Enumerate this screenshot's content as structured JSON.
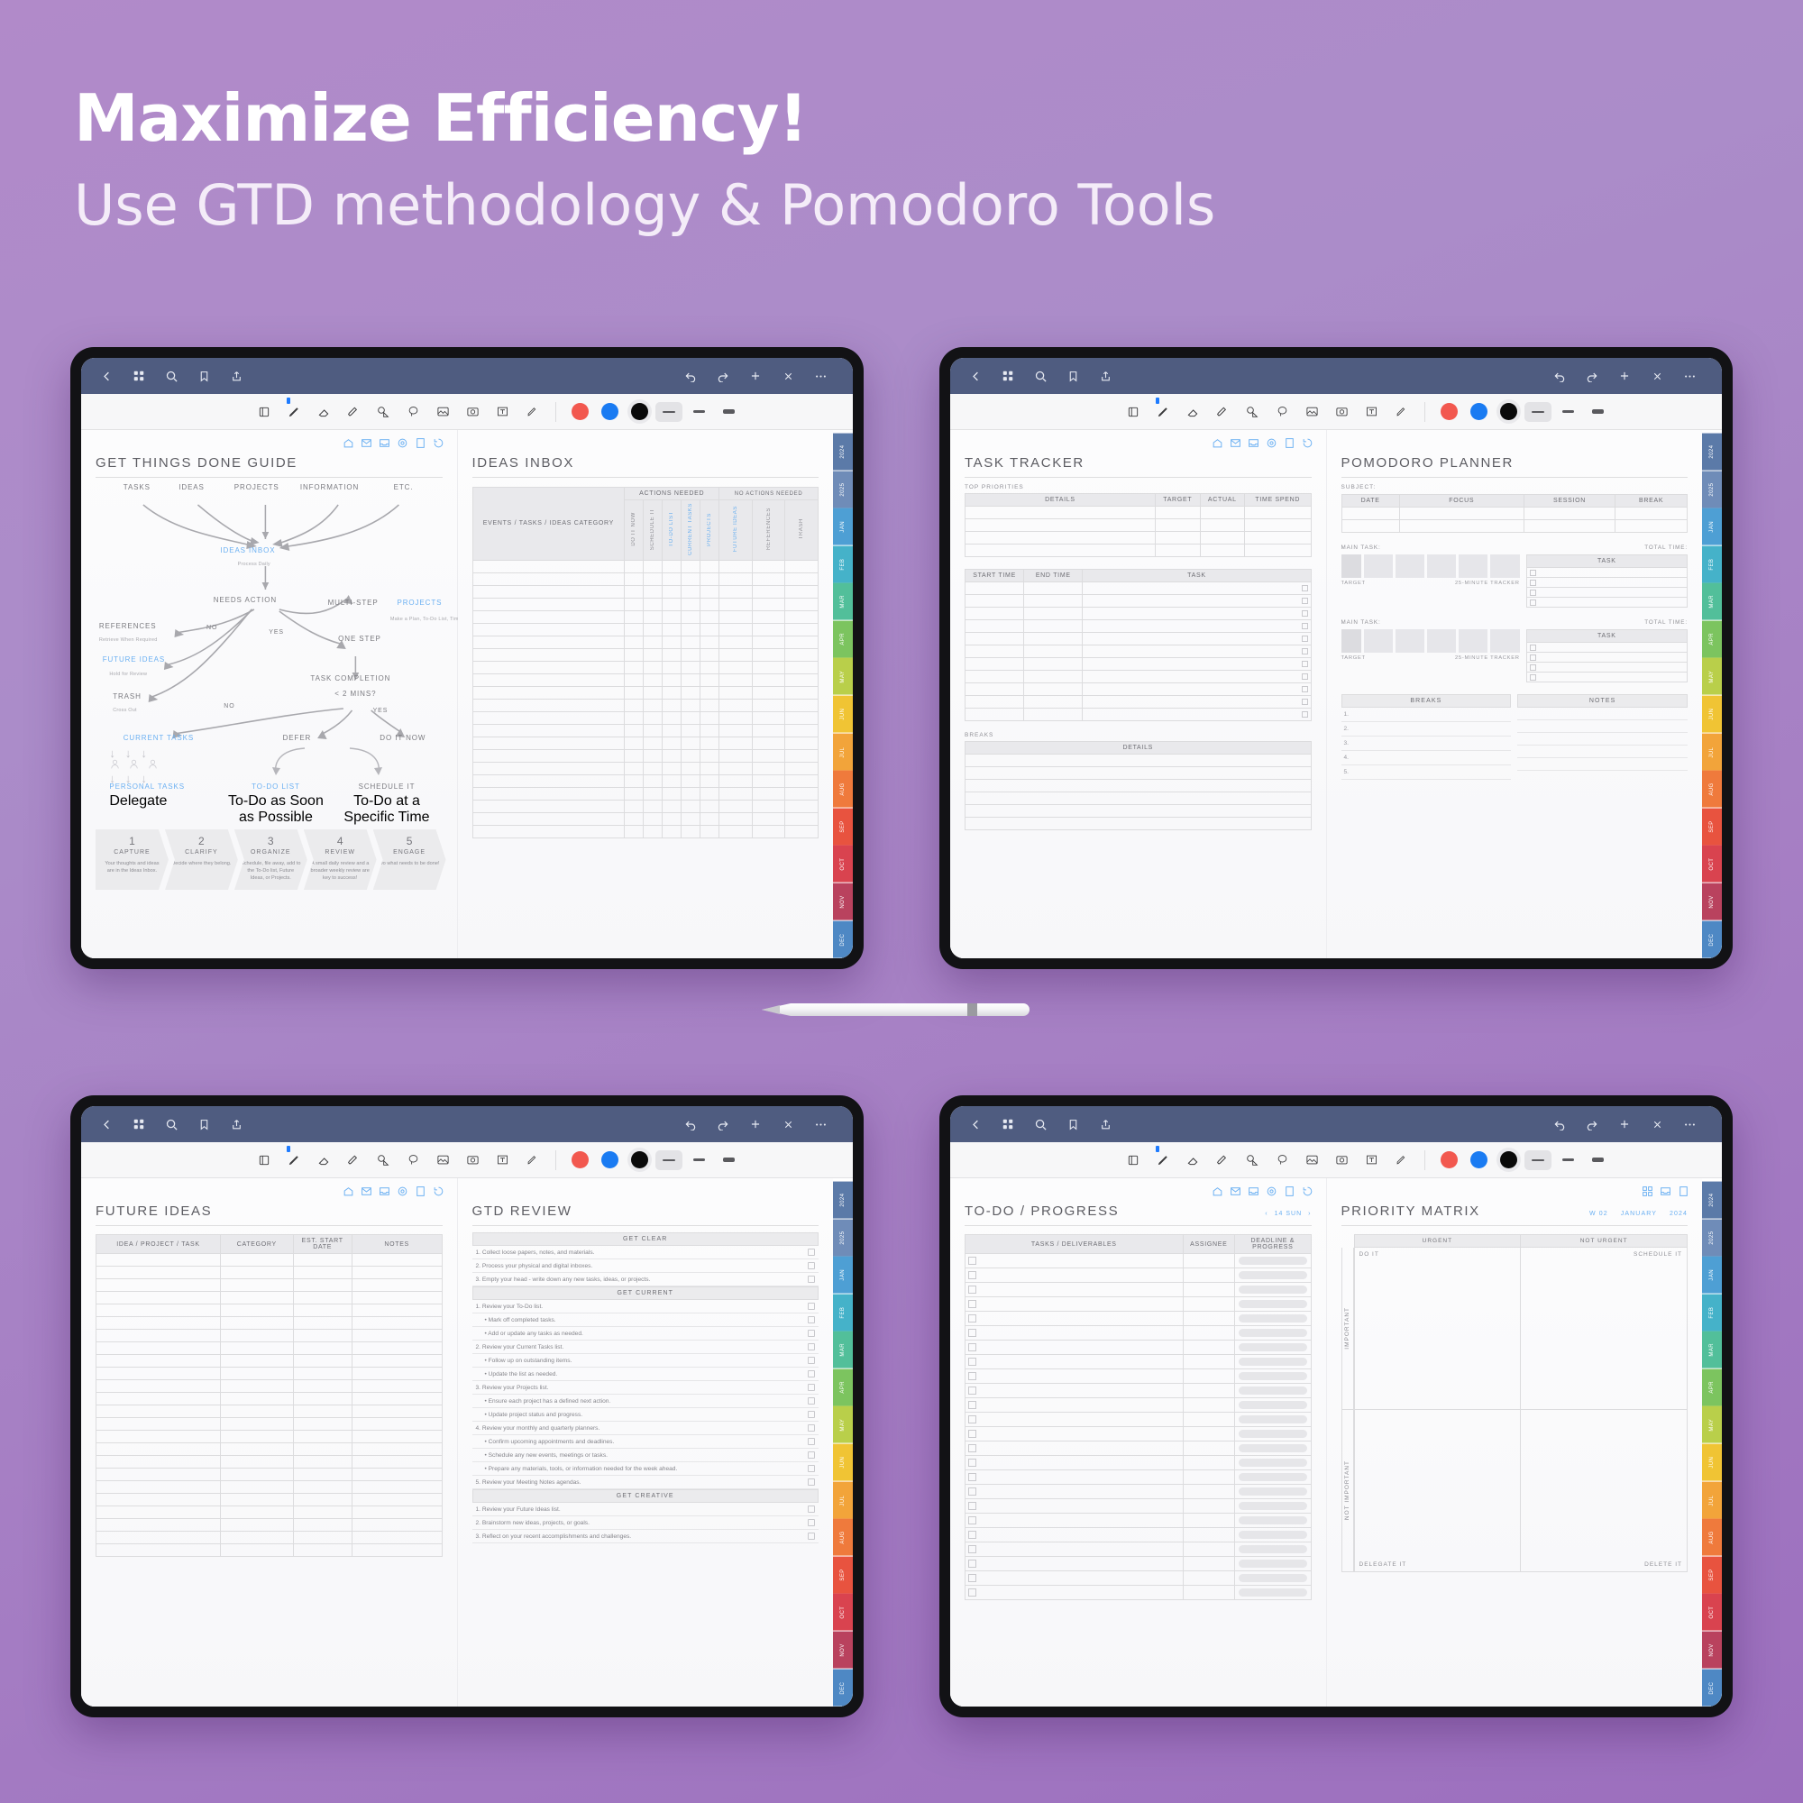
{
  "hero": {
    "title": "Maximize Efficiency!",
    "subtitle": "Use GTD methodology & Pomodoro Tools"
  },
  "colors": {
    "navbar": "#4f5c80",
    "accent_blue": "#6bb0f2",
    "pen_red": "#f2584f",
    "pen_blue": "#1a7bf2",
    "pen_black": "#0a0a0a",
    "background": "#a67fc4"
  },
  "navbar": {
    "icons": [
      "back-chevron-icon",
      "grid-icon",
      "search-icon",
      "bookmark-icon",
      "share-icon"
    ],
    "right_icons": [
      "undo-icon",
      "redo-icon",
      "plus-icon",
      "close-icon",
      "more-icon"
    ]
  },
  "toolbar": {
    "icons": [
      "page-flip-icon",
      "pen-icon",
      "eraser-icon",
      "highlighter-icon",
      "shape-icon",
      "lasso-icon",
      "image-icon",
      "camera-icon",
      "text-box-icon",
      "sticker-icon"
    ],
    "colors": [
      "red",
      "blue",
      "black"
    ],
    "widths": [
      "thin",
      "medium",
      "thick"
    ]
  },
  "quick_icons": [
    "home-icon",
    "inbox-icon",
    "tray-icon",
    "target-icon",
    "note-icon",
    "history-icon"
  ],
  "month_tabs": [
    "2024",
    "2025",
    "JAN",
    "FEB",
    "MAR",
    "APR",
    "MAY",
    "JUN",
    "JUL",
    "AUG",
    "SEP",
    "OCT",
    "NOV",
    "DEC"
  ],
  "month_colors": [
    "#5b7aa8",
    "#6f8cb8",
    "#4e9fd4",
    "#45b2c9",
    "#52bf9a",
    "#7cc45f",
    "#b9cf4a",
    "#f0c434",
    "#f2a43a",
    "#ef7a3c",
    "#e8533f",
    "#d9434f",
    "#b9425e",
    "#4e88c4"
  ],
  "tablet_top_left": {
    "left_page": {
      "title": "GET THINGS DONE GUIDE",
      "flow": {
        "inputs": [
          "TASKS",
          "IDEAS",
          "PROJECTS",
          "INFORMATION",
          "ETC."
        ],
        "inbox": "IDEAS INBOX",
        "inbox_sub": "Process Daily",
        "needs_action": "NEEDS ACTION",
        "references": "REFERENCES",
        "references_sub": "Retrieve When Required",
        "future_ideas": "FUTURE IDEAS",
        "future_ideas_sub": "Hold for Review",
        "trash": "TRASH",
        "trash_sub": "Cross Out",
        "multi_step": "MULTI-STEP",
        "projects": "PROJECTS",
        "projects_sub": "Make a Plan, To-Do List, Timeline, Budget, etc.",
        "one_step": "ONE STEP",
        "task_completion": "TASK COMPLETION",
        "task_completion_sub": "< 2 MINS?",
        "current_tasks": "CURRENT TASKS",
        "defer": "DEFER",
        "do_it_now": "DO IT NOW",
        "personal_tasks": "PERSONAL TASKS",
        "personal_tasks_sub": "Delegate",
        "todo_list": "TO-DO LIST",
        "todo_list_sub": "To-Do as Soon as Possible",
        "schedule_it": "SCHEDULE IT",
        "schedule_it_sub": "To-Do at a Specific Time",
        "labels": {
          "no": "NO",
          "yes": "YES"
        }
      },
      "steps": [
        {
          "num": "1",
          "name": "CAPTURE",
          "desc": "Your thoughts and ideas are in the Ideas Inbox."
        },
        {
          "num": "2",
          "name": "CLARIFY",
          "desc": "Decide where they belong."
        },
        {
          "num": "3",
          "name": "ORGANIZE",
          "desc": "Schedule, file away, add to the To-Do list, Future Ideas, or Projects."
        },
        {
          "num": "4",
          "name": "REVIEW",
          "desc": "A small daily review and a broader weekly review are key to success!"
        },
        {
          "num": "5",
          "name": "ENGAGE",
          "desc": "Do what needs to be done!"
        }
      ]
    },
    "right_page": {
      "title": "IDEAS INBOX",
      "group_headers": [
        "ACTIONS NEEDED",
        "NO ACTIONS NEEDED"
      ],
      "main_column": "EVENTS / TASKS / IDEAS CATEGORY",
      "vertical_columns": [
        "DO IT NOW",
        "SCHEDULE IT",
        "TO-DO LIST",
        "CURRENT TASKS",
        "PROJECTS",
        "FUTURE IDEAS",
        "REFERENCES",
        "TRASH"
      ],
      "row_count": 22
    }
  },
  "tablet_top_right": {
    "left_page": {
      "title": "TASK TRACKER",
      "section_top": "TOP PRIORITIES",
      "priority_columns": [
        "DETAILS",
        "TARGET",
        "ACTUAL",
        "TIME SPEND"
      ],
      "priority_rows": 4,
      "schedule_columns": [
        "START TIME",
        "END TIME",
        "TASK"
      ],
      "schedule_rows": 11,
      "breaks_label": "BREAKS",
      "breaks_column": "DETAILS",
      "breaks_rows": 6
    },
    "right_page": {
      "title": "POMODORO PLANNER",
      "subject_label": "SUBJECT:",
      "columns": [
        "DATE",
        "FOCUS",
        "SESSION",
        "BREAK"
      ],
      "rows": 2,
      "blocks": [
        {
          "main_task": "MAIN TASK:",
          "total_time": "TOTAL TIME:",
          "task_header": "TASK",
          "target": "TARGET",
          "tracker": "25-MINUTE TRACKER",
          "task_rows": 4
        },
        {
          "main_task": "MAIN TASK:",
          "total_time": "TOTAL TIME:",
          "task_header": "TASK",
          "target": "TARGET",
          "tracker": "25-MINUTE TRACKER",
          "task_rows": 4
        }
      ],
      "footer_left": "BREAKS",
      "footer_right": "NOTES",
      "break_numbers": [
        "1.",
        "2.",
        "3.",
        "4.",
        "5."
      ]
    }
  },
  "tablet_bottom_left": {
    "left_page": {
      "title": "FUTURE IDEAS",
      "columns": [
        "IDEA / PROJECT / TASK",
        "CATEGORY",
        "EST. START DATE",
        "NOTES"
      ],
      "row_count": 24
    },
    "right_page": {
      "title": "GTD REVIEW",
      "sections": [
        {
          "header": "GET CLEAR",
          "items": [
            {
              "text": "1. Collect loose papers, notes, and materials.",
              "indent": 0
            },
            {
              "text": "2. Process your physical and digital inboxes.",
              "indent": 0
            },
            {
              "text": "3. Empty your head - write down any new tasks, ideas, or projects.",
              "indent": 0
            }
          ]
        },
        {
          "header": "GET CURRENT",
          "items": [
            {
              "text": "1. Review your To-Do list.",
              "indent": 0
            },
            {
              "text": "• Mark off completed tasks.",
              "indent": 1
            },
            {
              "text": "• Add or update any tasks as needed.",
              "indent": 1
            },
            {
              "text": "2. Review your Current Tasks list.",
              "indent": 0
            },
            {
              "text": "• Follow up on outstanding items.",
              "indent": 1
            },
            {
              "text": "• Update the list as needed.",
              "indent": 1
            },
            {
              "text": "3. Review your Projects list.",
              "indent": 0
            },
            {
              "text": "• Ensure each project has a defined next action.",
              "indent": 1
            },
            {
              "text": "• Update project status and progress.",
              "indent": 1
            },
            {
              "text": "4. Review your monthly and quarterly planners.",
              "indent": 0
            },
            {
              "text": "• Confirm upcoming appointments and deadlines.",
              "indent": 1
            },
            {
              "text": "• Schedule any new events, meetings or tasks.",
              "indent": 1
            },
            {
              "text": "• Prepare any materials, tools, or information needed for the week ahead.",
              "indent": 1
            },
            {
              "text": "5. Review your Meeting Notes agendas.",
              "indent": 0
            }
          ]
        },
        {
          "header": "GET CREATIVE",
          "items": [
            {
              "text": "1. Review your Future Ideas list.",
              "indent": 0
            },
            {
              "text": "2. Brainstorm new ideas, projects, or goals.",
              "indent": 0
            },
            {
              "text": "3. Reflect on your recent accomplishments and challenges.",
              "indent": 0
            }
          ]
        }
      ]
    }
  },
  "tablet_bottom_right": {
    "left_page": {
      "title": "TO-DO / PROGRESS",
      "date_nav": "14 SUN",
      "columns": [
        "TASKS / DELIVERABLES",
        "ASSIGNEE",
        "DEADLINE & PROGRESS"
      ],
      "row_count": 24
    },
    "right_page": {
      "title": "PRIORITY MATRIX",
      "week": "W 02",
      "month": "JANUARY",
      "year": "2024",
      "col_headers": [
        "URGENT",
        "NOT URGENT"
      ],
      "row_headers": [
        "IMPORTANT",
        "NOT IMPORTANT"
      ],
      "quadrants": [
        "DO IT",
        "SCHEDULE IT",
        "DELEGATE IT",
        "DELETE IT"
      ]
    }
  }
}
